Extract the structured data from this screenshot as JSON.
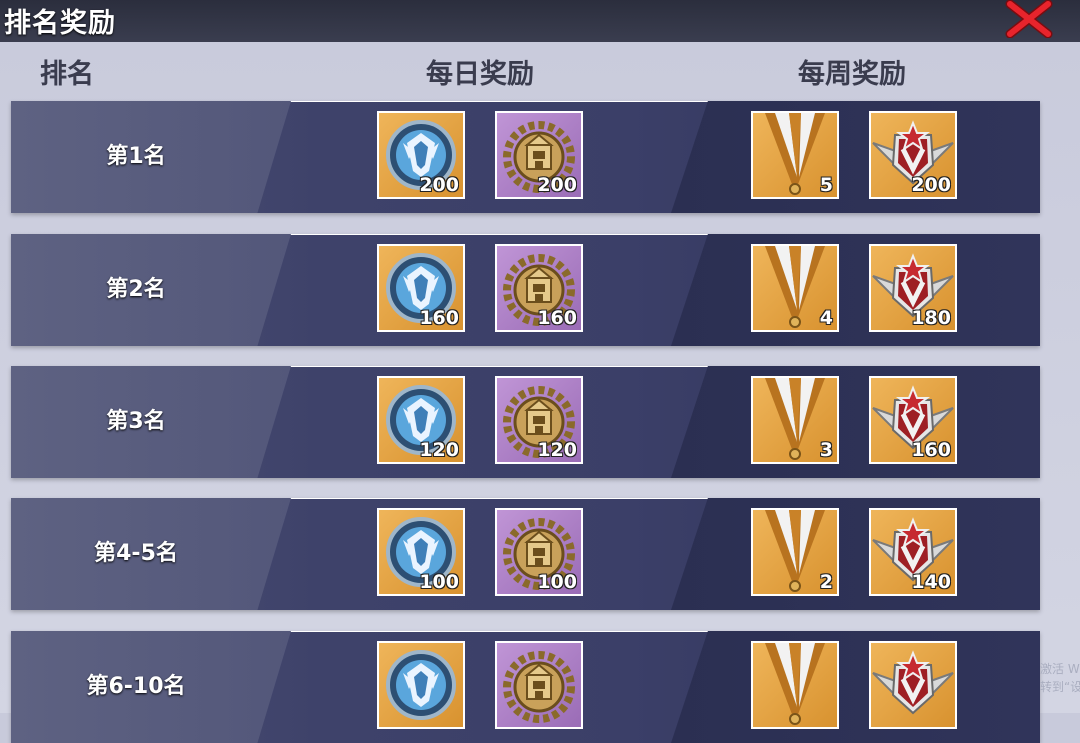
{
  "window": {
    "title": "排名奖励"
  },
  "headers": {
    "rank": "排名",
    "daily": "每日奖励",
    "weekly": "每周奖励"
  },
  "rows": [
    {
      "rank": "第1名",
      "daily": [
        {
          "icon": "blue-emblem-icon",
          "count": "200"
        },
        {
          "icon": "gold-fortress-medal-icon",
          "count": "200"
        }
      ],
      "weekly": [
        {
          "icon": "ribbon-medal-icon",
          "count": "5"
        },
        {
          "icon": "winged-star-badge-icon",
          "count": "200"
        }
      ]
    },
    {
      "rank": "第2名",
      "daily": [
        {
          "icon": "blue-emblem-icon",
          "count": "160"
        },
        {
          "icon": "gold-fortress-medal-icon",
          "count": "160"
        }
      ],
      "weekly": [
        {
          "icon": "ribbon-medal-icon",
          "count": "4"
        },
        {
          "icon": "winged-star-badge-icon",
          "count": "180"
        }
      ]
    },
    {
      "rank": "第3名",
      "daily": [
        {
          "icon": "blue-emblem-icon",
          "count": "120"
        },
        {
          "icon": "gold-fortress-medal-icon",
          "count": "120"
        }
      ],
      "weekly": [
        {
          "icon": "ribbon-medal-icon",
          "count": "3"
        },
        {
          "icon": "winged-star-badge-icon",
          "count": "160"
        }
      ]
    },
    {
      "rank": "第4-5名",
      "daily": [
        {
          "icon": "blue-emblem-icon",
          "count": "100"
        },
        {
          "icon": "gold-fortress-medal-icon",
          "count": "100"
        }
      ],
      "weekly": [
        {
          "icon": "ribbon-medal-icon",
          "count": "2"
        },
        {
          "icon": "winged-star-badge-icon",
          "count": "140"
        }
      ]
    },
    {
      "rank": "第6-10名",
      "daily": [
        {
          "icon": "blue-emblem-icon",
          "count": ""
        },
        {
          "icon": "gold-fortress-medal-icon",
          "count": ""
        }
      ],
      "weekly": [
        {
          "icon": "ribbon-medal-icon",
          "count": ""
        },
        {
          "icon": "winged-star-badge-icon",
          "count": ""
        }
      ]
    }
  ],
  "watermark": {
    "line1": "激活 W",
    "line2": "转到“设"
  },
  "colors": {
    "row_bg": "#3e426a",
    "item_gold": "#e6a647",
    "item_purple": "#a97bc3",
    "close_red": "#e8242c"
  }
}
